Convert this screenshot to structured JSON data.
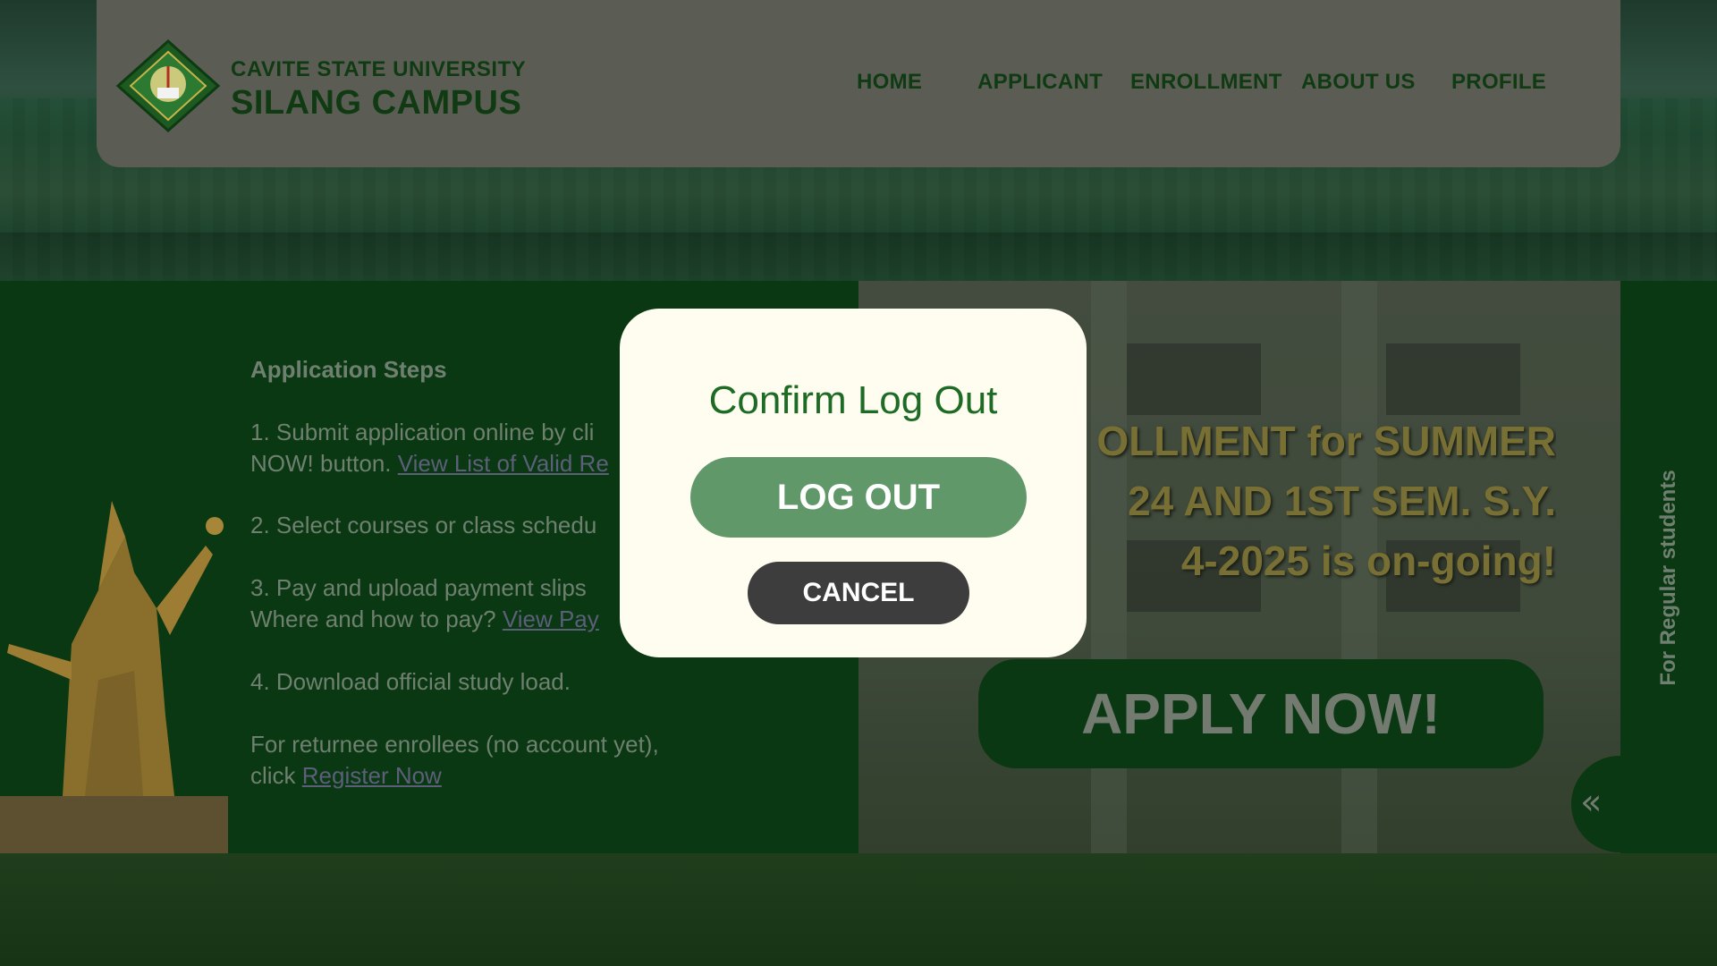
{
  "header": {
    "university": "CAVITE STATE UNIVERSITY",
    "campus": "SILANG CAMPUS",
    "logo_icon": "university-seal-icon",
    "nav": [
      "HOME",
      "APPLICANT",
      "ENROLLMENT",
      "ABOUT US",
      "PROFILE"
    ]
  },
  "steps": {
    "title": "Application Steps",
    "step1_text": "1. Submit application online by cli",
    "step1_text2": "NOW! button. ",
    "step1_link": "View List of Valid Re",
    "step2_text": "2. Select courses or class schedu",
    "step3_text": "3. Pay and upload payment slips",
    "step3_text2": "Where and how to pay? ",
    "step3_link": "View Pay",
    "step4_text": "4. Download official study load.",
    "returnee_text": "For returnee enrollees (no account yet),",
    "returnee_text2": "click  ",
    "returnee_link": "Register Now"
  },
  "hero": {
    "line1": "OLLMENT for SUMMER",
    "line2": "24 AND 1ST SEM. S.Y.",
    "line3": "4-2025 is on-going!",
    "apply_label": "APPLY NOW!",
    "side_label": "For Regular students",
    "collapse_icon": "double-chevron-left-icon",
    "collapse_glyph": "«"
  },
  "modal": {
    "title": "Confirm Log Out",
    "logout_label": "LOG OUT",
    "cancel_label": "CANCEL"
  },
  "colors": {
    "brand_green": "#0a3812",
    "logout_green": "#61986a",
    "modal_bg": "#fefdf0",
    "cancel_dark": "#3d3d3d"
  }
}
